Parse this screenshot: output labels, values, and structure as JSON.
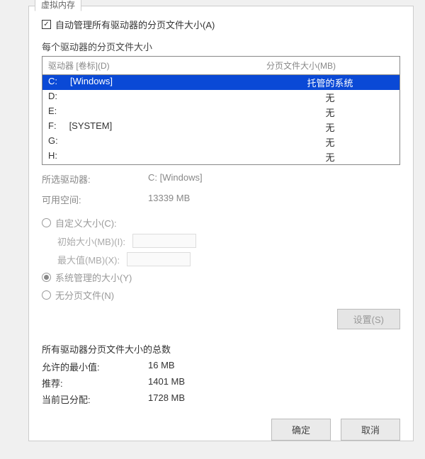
{
  "tab": "虚拟内存",
  "auto_manage_label": "自动管理所有驱动器的分页文件大小(A)",
  "auto_manage_checked": true,
  "section_each_drive": "每个驱动器的分页文件大小",
  "table": {
    "header_drive": "驱动器 [卷标](D)",
    "header_size": "分页文件大小(MB)",
    "rows": [
      {
        "drive": "C:",
        "label": "[Windows]",
        "size": "托管的系统",
        "selected": true
      },
      {
        "drive": "D:",
        "label": "",
        "size": "无",
        "selected": false
      },
      {
        "drive": "E:",
        "label": "",
        "size": "无",
        "selected": false
      },
      {
        "drive": "F:",
        "label": "[SYSTEM]",
        "size": "无",
        "selected": false
      },
      {
        "drive": "G:",
        "label": "",
        "size": "无",
        "selected": false
      },
      {
        "drive": "H:",
        "label": "",
        "size": "无",
        "selected": false
      }
    ]
  },
  "selected_drive_label": "所选驱动器:",
  "selected_drive_value": "C: [Windows]",
  "free_space_label": "可用空间:",
  "free_space_value": "13339 MB",
  "custom_size_label": "自定义大小(C):",
  "initial_size_label": "初始大小(MB)(I):",
  "max_size_label": "最大值(MB)(X):",
  "system_managed_label": "系统管理的大小(Y)",
  "no_paging_label": "无分页文件(N)",
  "selected_radio": "system",
  "set_button": "设置(S)",
  "totals": {
    "header": "所有驱动器分页文件大小的总数",
    "min_label": "允许的最小值:",
    "min_value": "16 MB",
    "rec_label": "推荐:",
    "rec_value": "1401 MB",
    "cur_label": "当前已分配:",
    "cur_value": "1728 MB"
  },
  "ok_button": "确定",
  "cancel_button": "取消"
}
